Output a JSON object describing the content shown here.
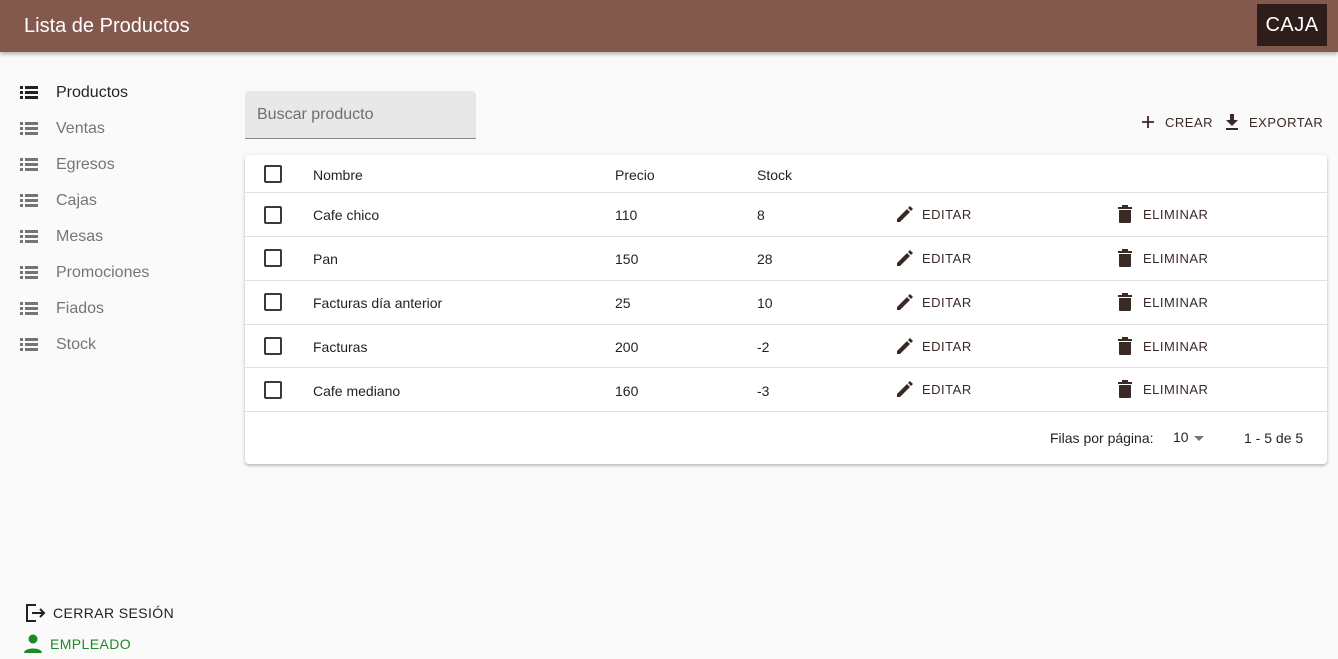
{
  "appbar": {
    "title": "Lista de Productos",
    "caja_label": "CAJA"
  },
  "sidebar": {
    "items": [
      {
        "label": "Productos",
        "icon": "list-icon",
        "active": true
      },
      {
        "label": "Ventas",
        "icon": "list-icon"
      },
      {
        "label": "Egresos",
        "icon": "list-icon"
      },
      {
        "label": "Cajas",
        "icon": "list-icon"
      },
      {
        "label": "Mesas",
        "icon": "list-icon"
      },
      {
        "label": "Promociones",
        "icon": "list-icon"
      },
      {
        "label": "Fiados",
        "icon": "list-icon"
      },
      {
        "label": "Stock",
        "icon": "list-icon"
      }
    ],
    "logout_label": "CERRAR SESIÓN",
    "user_label": "EMPLEADO",
    "user_color": "#1b8a2a"
  },
  "search": {
    "placeholder": "Buscar producto",
    "value": ""
  },
  "toolbar": {
    "create_label": "CREAR",
    "export_label": "EXPORTAR"
  },
  "table": {
    "columns": [
      "Nombre",
      "Precio",
      "Stock"
    ],
    "rows": [
      {
        "nombre": "Cafe chico",
        "precio": "110",
        "stock": "8"
      },
      {
        "nombre": "Pan",
        "precio": "150",
        "stock": "28"
      },
      {
        "nombre": "Facturas día anterior",
        "precio": "25",
        "stock": "10"
      },
      {
        "nombre": "Facturas",
        "precio": "200",
        "stock": "-2"
      },
      {
        "nombre": "Cafe mediano",
        "precio": "160",
        "stock": "-3"
      }
    ],
    "edit_label": "EDITAR",
    "delete_label": "ELIMINAR"
  },
  "pagination": {
    "rows_per_page_label": "Filas por página:",
    "rows_per_page": "10",
    "range": "1 - 5 de 5"
  },
  "colors": {
    "appbar": "#83584d",
    "caja_button": "#2e1d1a",
    "action_text": "#3a2a26"
  }
}
